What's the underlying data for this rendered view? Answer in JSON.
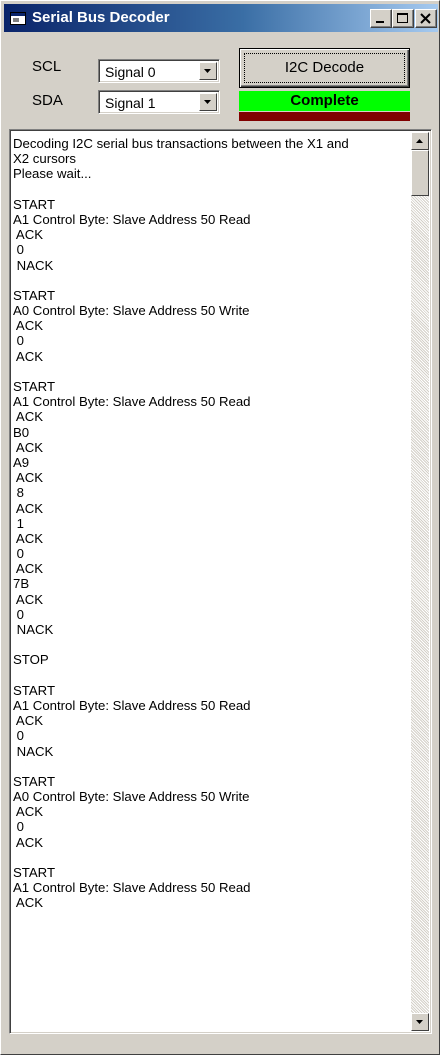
{
  "window": {
    "title": "Serial Bus Decoder"
  },
  "controls": {
    "scl_label": "SCL",
    "sda_label": "SDA",
    "scl_value": "Signal 0",
    "sda_value": "Signal 1",
    "decode_label": "I2C Decode",
    "status_text": "Complete"
  },
  "colors": {
    "status_bg": "#00ff00",
    "status_under": "#800000",
    "titlebar_start": "#0a246a",
    "titlebar_end": "#a6caf0"
  },
  "icons": {
    "app": "app-window-icon",
    "minimize": "minimize-icon",
    "maximize": "maximize-icon",
    "close": "close-icon",
    "dropdown": "chevron-down-icon",
    "scroll_up": "scroll-up-arrow-icon",
    "scroll_down": "scroll-down-arrow-icon"
  },
  "log": {
    "lines": [
      "Decoding I2C serial bus transactions between the X1 and",
      "X2 cursors",
      "Please wait...",
      "",
      "START",
      "A1 Control Byte: Slave Address 50 Read",
      " ACK",
      " 0",
      " NACK",
      "",
      "START",
      "A0 Control Byte: Slave Address 50 Write",
      " ACK",
      " 0",
      " ACK",
      "",
      "START",
      "A1 Control Byte: Slave Address 50 Read",
      " ACK",
      "B0",
      " ACK",
      "A9",
      " ACK",
      " 8",
      " ACK",
      " 1",
      " ACK",
      " 0",
      " ACK",
      "7B",
      " ACK",
      " 0",
      " NACK",
      "",
      "STOP",
      "",
      "START",
      "A1 Control Byte: Slave Address 50 Read",
      " ACK",
      " 0",
      " NACK",
      "",
      "START",
      "A0 Control Byte: Slave Address 50 Write",
      " ACK",
      " 0",
      " ACK",
      "",
      "START",
      "A1 Control Byte: Slave Address 50 Read",
      " ACK"
    ]
  }
}
